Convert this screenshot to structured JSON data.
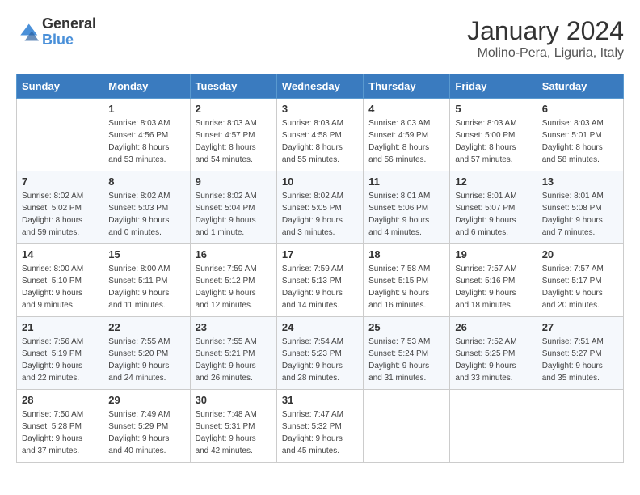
{
  "header": {
    "logo_text_general": "General",
    "logo_text_blue": "Blue",
    "month_year": "January 2024",
    "location": "Molino-Pera, Liguria, Italy"
  },
  "weekdays": [
    "Sunday",
    "Monday",
    "Tuesday",
    "Wednesday",
    "Thursday",
    "Friday",
    "Saturday"
  ],
  "weeks": [
    [
      {
        "day": "",
        "info": ""
      },
      {
        "day": "1",
        "info": "Sunrise: 8:03 AM\nSunset: 4:56 PM\nDaylight: 8 hours\nand 53 minutes."
      },
      {
        "day": "2",
        "info": "Sunrise: 8:03 AM\nSunset: 4:57 PM\nDaylight: 8 hours\nand 54 minutes."
      },
      {
        "day": "3",
        "info": "Sunrise: 8:03 AM\nSunset: 4:58 PM\nDaylight: 8 hours\nand 55 minutes."
      },
      {
        "day": "4",
        "info": "Sunrise: 8:03 AM\nSunset: 4:59 PM\nDaylight: 8 hours\nand 56 minutes."
      },
      {
        "day": "5",
        "info": "Sunrise: 8:03 AM\nSunset: 5:00 PM\nDaylight: 8 hours\nand 57 minutes."
      },
      {
        "day": "6",
        "info": "Sunrise: 8:03 AM\nSunset: 5:01 PM\nDaylight: 8 hours\nand 58 minutes."
      }
    ],
    [
      {
        "day": "7",
        "info": "Sunrise: 8:02 AM\nSunset: 5:02 PM\nDaylight: 8 hours\nand 59 minutes."
      },
      {
        "day": "8",
        "info": "Sunrise: 8:02 AM\nSunset: 5:03 PM\nDaylight: 9 hours\nand 0 minutes."
      },
      {
        "day": "9",
        "info": "Sunrise: 8:02 AM\nSunset: 5:04 PM\nDaylight: 9 hours\nand 1 minute."
      },
      {
        "day": "10",
        "info": "Sunrise: 8:02 AM\nSunset: 5:05 PM\nDaylight: 9 hours\nand 3 minutes."
      },
      {
        "day": "11",
        "info": "Sunrise: 8:01 AM\nSunset: 5:06 PM\nDaylight: 9 hours\nand 4 minutes."
      },
      {
        "day": "12",
        "info": "Sunrise: 8:01 AM\nSunset: 5:07 PM\nDaylight: 9 hours\nand 6 minutes."
      },
      {
        "day": "13",
        "info": "Sunrise: 8:01 AM\nSunset: 5:08 PM\nDaylight: 9 hours\nand 7 minutes."
      }
    ],
    [
      {
        "day": "14",
        "info": "Sunrise: 8:00 AM\nSunset: 5:10 PM\nDaylight: 9 hours\nand 9 minutes."
      },
      {
        "day": "15",
        "info": "Sunrise: 8:00 AM\nSunset: 5:11 PM\nDaylight: 9 hours\nand 11 minutes."
      },
      {
        "day": "16",
        "info": "Sunrise: 7:59 AM\nSunset: 5:12 PM\nDaylight: 9 hours\nand 12 minutes."
      },
      {
        "day": "17",
        "info": "Sunrise: 7:59 AM\nSunset: 5:13 PM\nDaylight: 9 hours\nand 14 minutes."
      },
      {
        "day": "18",
        "info": "Sunrise: 7:58 AM\nSunset: 5:15 PM\nDaylight: 9 hours\nand 16 minutes."
      },
      {
        "day": "19",
        "info": "Sunrise: 7:57 AM\nSunset: 5:16 PM\nDaylight: 9 hours\nand 18 minutes."
      },
      {
        "day": "20",
        "info": "Sunrise: 7:57 AM\nSunset: 5:17 PM\nDaylight: 9 hours\nand 20 minutes."
      }
    ],
    [
      {
        "day": "21",
        "info": "Sunrise: 7:56 AM\nSunset: 5:19 PM\nDaylight: 9 hours\nand 22 minutes."
      },
      {
        "day": "22",
        "info": "Sunrise: 7:55 AM\nSunset: 5:20 PM\nDaylight: 9 hours\nand 24 minutes."
      },
      {
        "day": "23",
        "info": "Sunrise: 7:55 AM\nSunset: 5:21 PM\nDaylight: 9 hours\nand 26 minutes."
      },
      {
        "day": "24",
        "info": "Sunrise: 7:54 AM\nSunset: 5:23 PM\nDaylight: 9 hours\nand 28 minutes."
      },
      {
        "day": "25",
        "info": "Sunrise: 7:53 AM\nSunset: 5:24 PM\nDaylight: 9 hours\nand 31 minutes."
      },
      {
        "day": "26",
        "info": "Sunrise: 7:52 AM\nSunset: 5:25 PM\nDaylight: 9 hours\nand 33 minutes."
      },
      {
        "day": "27",
        "info": "Sunrise: 7:51 AM\nSunset: 5:27 PM\nDaylight: 9 hours\nand 35 minutes."
      }
    ],
    [
      {
        "day": "28",
        "info": "Sunrise: 7:50 AM\nSunset: 5:28 PM\nDaylight: 9 hours\nand 37 minutes."
      },
      {
        "day": "29",
        "info": "Sunrise: 7:49 AM\nSunset: 5:29 PM\nDaylight: 9 hours\nand 40 minutes."
      },
      {
        "day": "30",
        "info": "Sunrise: 7:48 AM\nSunset: 5:31 PM\nDaylight: 9 hours\nand 42 minutes."
      },
      {
        "day": "31",
        "info": "Sunrise: 7:47 AM\nSunset: 5:32 PM\nDaylight: 9 hours\nand 45 minutes."
      },
      {
        "day": "",
        "info": ""
      },
      {
        "day": "",
        "info": ""
      },
      {
        "day": "",
        "info": ""
      }
    ]
  ]
}
